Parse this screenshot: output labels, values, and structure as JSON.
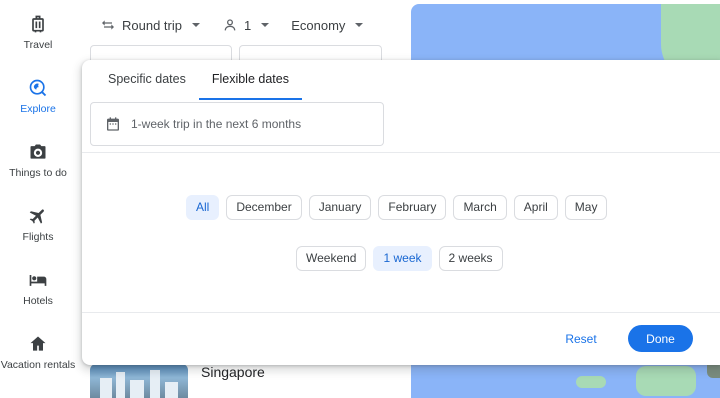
{
  "sidebar": {
    "items": [
      {
        "label": "Travel",
        "icon": "suitcase-icon"
      },
      {
        "label": "Explore",
        "icon": "explore-icon",
        "active": true
      },
      {
        "label": "Things to do",
        "icon": "camera-icon"
      },
      {
        "label": "Flights",
        "icon": "airplane-icon"
      },
      {
        "label": "Hotels",
        "icon": "bed-icon"
      },
      {
        "label": "Vacation rentals",
        "icon": "house-icon"
      }
    ]
  },
  "toolbar": {
    "trip_type": "Round trip",
    "passengers": "1",
    "cabin_class": "Economy"
  },
  "date_picker": {
    "tabs": [
      {
        "label": "Specific dates",
        "active": false
      },
      {
        "label": "Flexible dates",
        "active": true
      }
    ],
    "field_text": "1-week trip in the next 6 months",
    "months": [
      {
        "label": "All",
        "selected": true
      },
      {
        "label": "December",
        "selected": false
      },
      {
        "label": "January",
        "selected": false
      },
      {
        "label": "February",
        "selected": false
      },
      {
        "label": "March",
        "selected": false
      },
      {
        "label": "April",
        "selected": false
      },
      {
        "label": "May",
        "selected": false
      }
    ],
    "durations": [
      {
        "label": "Weekend",
        "selected": false
      },
      {
        "label": "1 week",
        "selected": true
      },
      {
        "label": "2 weeks",
        "selected": false
      }
    ],
    "reset_label": "Reset",
    "done_label": "Done"
  },
  "results": {
    "first_destination": "Singapore"
  },
  "colors": {
    "accent": "#1a73e8",
    "chip_selected_bg": "#e8f0fe",
    "map_water": "#8ab4f8",
    "map_land": "#a8dab5"
  }
}
